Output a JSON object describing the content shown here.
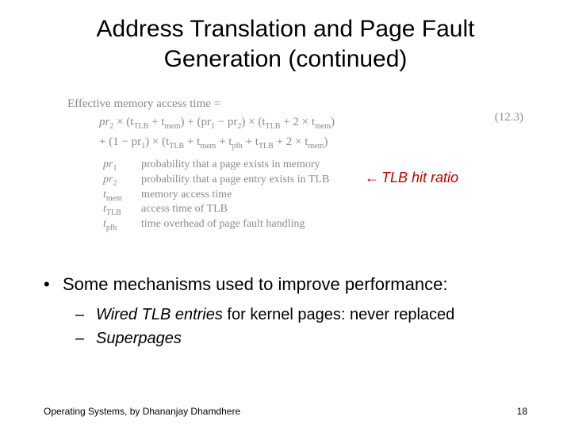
{
  "title_l1": "Address Translation and Page Fault",
  "title_l2": "Generation (continued)",
  "formula": {
    "lead": "Effective memory access time =",
    "line2_a": "pr",
    "line2_a_sub": "2",
    "line2_b": " × (t",
    "line2_b_sub": "TLB",
    "line2_c": " + t",
    "line2_c_sub": "mem",
    "line2_d": ") + (pr",
    "line2_d_sub": "1",
    "line2_e": " − pr",
    "line2_e_sub": "2",
    "line2_f": ") × (t",
    "line2_f_sub": "TLB",
    "line2_g": " + 2 × t",
    "line2_g_sub": "mem",
    "line2_h": ")",
    "line3_a": "+ (1 − pr",
    "line3_a_sub": "1",
    "line3_b": ") × (t",
    "line3_b_sub": "TLB",
    "line3_c": " + t",
    "line3_c_sub": "mem",
    "line3_d": " + t",
    "line3_d_sub": "pfh",
    "line3_e": " + t",
    "line3_e_sub": "TLB",
    "line3_f": " + 2 × t",
    "line3_f_sub": "mem",
    "line3_g": ")"
  },
  "eqnum": "(12.3)",
  "defs": [
    {
      "sym": "pr",
      "sub": "1",
      "desc": "probability that a page exists in memory"
    },
    {
      "sym": "pr",
      "sub": "2",
      "desc": "probability that a page entry exists in TLB"
    },
    {
      "sym": "t",
      "sub": "mem",
      "desc": "memory access time"
    },
    {
      "sym": "t",
      "sub": "TLB",
      "desc": "access time of TLB"
    },
    {
      "sym": "t",
      "sub": "pfh",
      "desc": "time overhead of page fault handling"
    }
  ],
  "annot": {
    "arrow": "←",
    "text": "TLB hit ratio"
  },
  "bullets": {
    "b1": "Some mechanisms used to improve performance:",
    "s1_em": "Wired TLB entries",
    "s1_rest": " for kernel pages: never replaced",
    "s2_em": "Superpages"
  },
  "footer_l": "Operating Systems, by Dhananjay Dhamdhere",
  "footer_r": "18"
}
